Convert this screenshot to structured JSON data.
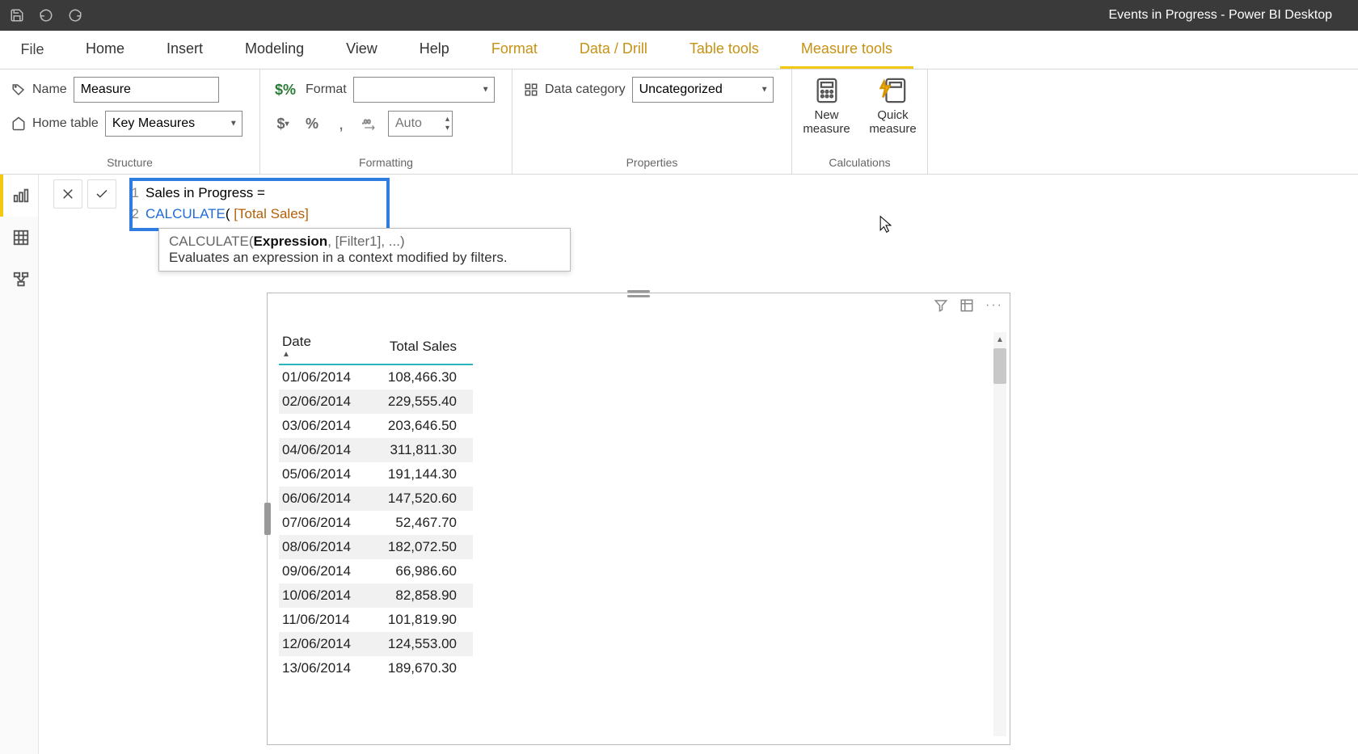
{
  "titlebar": {
    "title": "Events in Progress - Power BI Desktop"
  },
  "tabs": {
    "file": "File",
    "items": [
      {
        "label": "Home",
        "ctx": false
      },
      {
        "label": "Insert",
        "ctx": false
      },
      {
        "label": "Modeling",
        "ctx": false
      },
      {
        "label": "View",
        "ctx": false
      },
      {
        "label": "Help",
        "ctx": false
      },
      {
        "label": "Format",
        "ctx": true
      },
      {
        "label": "Data / Drill",
        "ctx": true
      },
      {
        "label": "Table tools",
        "ctx": true
      },
      {
        "label": "Measure tools",
        "ctx": true,
        "active": true
      }
    ]
  },
  "ribbon": {
    "structure": {
      "name_label": "Name",
      "name_value": "Measure",
      "home_table_label": "Home table",
      "home_table_value": "Key Measures",
      "group_label": "Structure"
    },
    "formatting": {
      "format_label": "Format",
      "format_value": "",
      "auto_placeholder": "Auto",
      "group_label": "Formatting"
    },
    "properties": {
      "data_category_label": "Data category",
      "data_category_value": "Uncategorized",
      "group_label": "Properties"
    },
    "calculations": {
      "new_measure": "New\nmeasure",
      "quick_measure": "Quick\nmeasure",
      "group_label": "Calculations"
    }
  },
  "formula": {
    "line1_num": "1",
    "line1_text": "Sales in Progress =",
    "line2_num": "2",
    "line2_calc": "CALCULATE",
    "line2_paren": "( ",
    "line2_meas": "[Total Sales]",
    "tooltip_sig_pre": "CALCULATE(",
    "tooltip_sig_bold": "Expression",
    "tooltip_sig_post": ", [Filter1], ...)",
    "tooltip_desc": "Evaluates an expression in a context modified by filters."
  },
  "table": {
    "headers": [
      "Date",
      "Total Sales"
    ],
    "rows": [
      {
        "date": "01/06/2014",
        "val": "108,466.30"
      },
      {
        "date": "02/06/2014",
        "val": "229,555.40"
      },
      {
        "date": "03/06/2014",
        "val": "203,646.50"
      },
      {
        "date": "04/06/2014",
        "val": "311,811.30"
      },
      {
        "date": "05/06/2014",
        "val": "191,144.30"
      },
      {
        "date": "06/06/2014",
        "val": "147,520.60"
      },
      {
        "date": "07/06/2014",
        "val": "52,467.70"
      },
      {
        "date": "08/06/2014",
        "val": "182,072.50"
      },
      {
        "date": "09/06/2014",
        "val": "66,986.60"
      },
      {
        "date": "10/06/2014",
        "val": "82,858.90"
      },
      {
        "date": "11/06/2014",
        "val": "101,819.90"
      },
      {
        "date": "12/06/2014",
        "val": "124,553.00"
      },
      {
        "date": "13/06/2014",
        "val": "189,670.30"
      }
    ]
  }
}
